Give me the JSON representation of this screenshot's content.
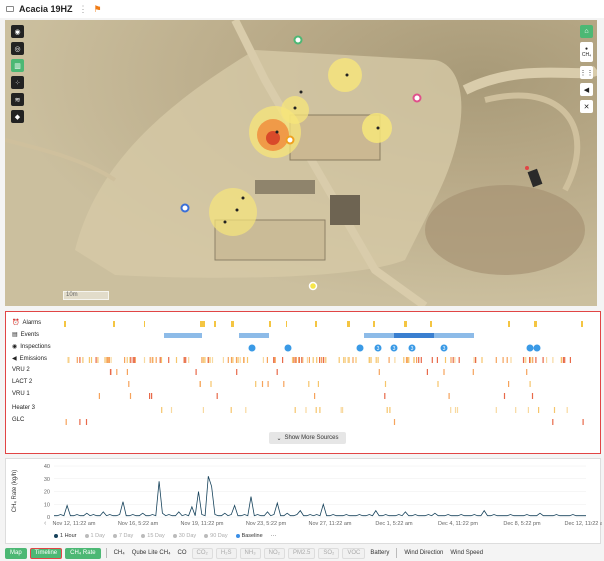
{
  "topbar": {
    "site_name": "Acacia 19HZ",
    "menu_icon": "kebab-icon",
    "flag_icon": "flag-icon"
  },
  "map": {
    "left_tools": [
      "compass-icon",
      "target-icon",
      "building-icon",
      "wells-icon",
      "wind-icon",
      "layers-icon"
    ],
    "right_tools": [
      "home-icon",
      "methane-icon",
      "grid-icon",
      "camera-icon",
      "drone-icon"
    ],
    "ch4_label": "CH₄",
    "scale_text": "10m"
  },
  "timeline": {
    "rows": [
      {
        "label": "Alarms",
        "icon": "alarm-icon"
      },
      {
        "label": "Events",
        "icon": "calendar-icon"
      },
      {
        "label": "Inspections",
        "icon": "eye-icon"
      },
      {
        "label": "Emissions",
        "icon": "speaker-icon"
      },
      {
        "label": "VRU 2",
        "icon": ""
      },
      {
        "label": "LACT 2",
        "icon": ""
      },
      {
        "label": "VRU 1",
        "icon": ""
      },
      {
        "label": "Heater 3",
        "icon": ""
      },
      {
        "label": "GLC",
        "icon": ""
      }
    ],
    "inspection_markers": [
      "",
      "",
      "",
      "3",
      "3",
      "3",
      "3",
      "",
      ""
    ],
    "show_more_label": "Show More Sources"
  },
  "chart_data": {
    "type": "line",
    "ylabel": "CH₄ Rate (kg/h)",
    "ylim": [
      0,
      40
    ],
    "yticks": [
      "40",
      "30",
      "20",
      "10",
      "0"
    ],
    "x_ticks": [
      "Nov 12, 11:22 am",
      "Nov 16, 5:22 am",
      "Nov 19, 11:22 pm",
      "Nov 23, 5:22 pm",
      "Nov 27, 11:22 am",
      "Dec 1, 5:22 am",
      "Dec 4, 11:22 pm",
      "Dec 8, 5:22 pm",
      "Dec 12, 11:22 am"
    ],
    "series": [
      {
        "name": "1 Hour",
        "values": [
          1,
          1,
          2,
          1,
          9,
          1,
          1,
          2,
          1,
          1,
          3,
          1,
          2,
          1,
          1,
          4,
          1,
          2,
          1,
          1,
          2,
          12,
          1,
          1,
          2,
          1,
          1,
          3,
          1,
          1,
          2,
          1,
          28,
          3,
          1,
          2,
          1,
          1,
          4,
          1,
          2,
          1,
          8,
          1,
          20,
          2,
          1,
          32,
          24,
          2,
          1,
          1,
          3,
          1,
          2,
          9,
          1,
          1,
          2,
          1,
          16,
          1,
          2,
          1,
          1,
          4,
          1,
          2,
          11,
          1,
          1,
          3,
          1,
          1,
          2,
          5,
          1,
          1,
          2,
          1,
          2,
          1,
          10,
          1,
          1,
          2,
          1,
          1,
          1,
          2,
          1,
          1,
          1,
          2,
          1,
          1,
          2,
          1,
          5,
          1,
          1,
          2,
          1,
          1,
          1,
          2,
          1,
          4,
          1,
          1,
          2,
          1,
          1,
          1,
          2,
          1,
          3,
          1,
          1,
          1,
          2,
          1,
          1,
          1,
          2,
          1,
          1,
          1,
          2,
          1,
          1,
          5,
          1,
          1,
          2,
          1,
          1,
          1,
          1,
          2,
          1,
          1,
          1,
          1,
          2,
          1,
          1,
          1,
          3,
          1,
          1,
          1,
          1,
          2,
          1,
          1,
          1,
          1,
          2,
          1,
          1,
          1,
          1
        ]
      }
    ],
    "legend": [
      {
        "label": "1 Hour",
        "active": true,
        "color": "#16425b"
      },
      {
        "label": "1 Day",
        "active": false,
        "color": "#bbbbbb"
      },
      {
        "label": "7 Day",
        "active": false,
        "color": "#bbbbbb"
      },
      {
        "label": "15 Day",
        "active": false,
        "color": "#bbbbbb"
      },
      {
        "label": "30 Day",
        "active": false,
        "color": "#bbbbbb"
      },
      {
        "label": "90 Day",
        "active": false,
        "color": "#bbbbbb"
      },
      {
        "label": "Baseline",
        "active": true,
        "color": "#3a8ee6"
      }
    ],
    "more_label": "···"
  },
  "bottombar": {
    "map": "Map",
    "timeline": "Timeline",
    "ch4_rate": "CH₄ Rate",
    "gases": [
      "CH₄",
      "Qube Lite CH₄",
      "CO",
      "CO₂",
      "H₂S",
      "NH₃",
      "NO₂",
      "PM2.5",
      "SO₂",
      "VOC"
    ],
    "battery": "Battery",
    "wind_direction": "Wind Direction",
    "wind_speed": "Wind Speed"
  },
  "colors": {
    "accent": "#4cb874",
    "highlight": "#e14545",
    "line": "#16425b",
    "emission": "#f6a35c"
  }
}
